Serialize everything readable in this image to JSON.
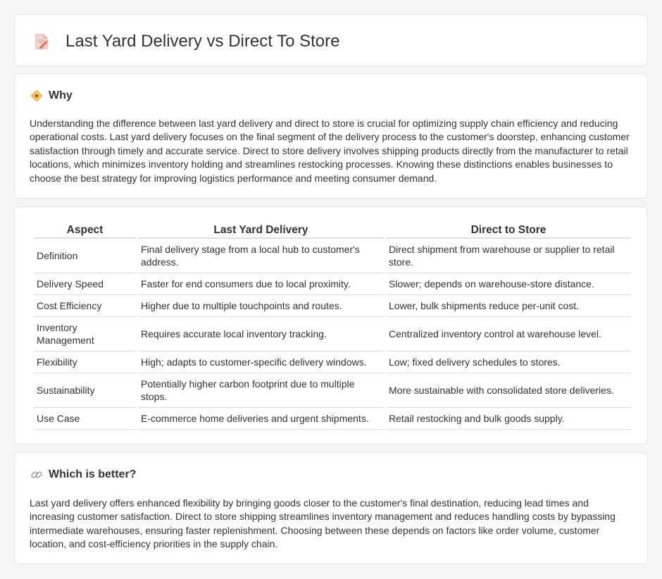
{
  "header": {
    "title": "Last Yard Delivery vs Direct To Store",
    "icon": "document-pencil-icon"
  },
  "why": {
    "heading": "Why",
    "icon": "diamond-sign-icon",
    "text": "Understanding the difference between last yard delivery and direct to store is crucial for optimizing supply chain efficiency and reducing operational costs. Last yard delivery focuses on the final segment of the delivery process to the customer's doorstep, enhancing customer satisfaction through timely and accurate service. Direct to store delivery involves shipping products directly from the manufacturer to retail locations, which minimizes inventory holding and streamlines restocking processes. Knowing these distinctions enables businesses to choose the best strategy for improving logistics performance and meeting consumer demand."
  },
  "table": {
    "headers": [
      "Aspect",
      "Last Yard Delivery",
      "Direct to Store"
    ],
    "rows": [
      [
        "Definition",
        "Final delivery stage from a local hub to customer's address.",
        "Direct shipment from warehouse or supplier to retail store."
      ],
      [
        "Delivery Speed",
        "Faster for end consumers due to local proximity.",
        "Slower; depends on warehouse-store distance."
      ],
      [
        "Cost Efficiency",
        "Higher due to multiple touchpoints and routes.",
        "Lower, bulk shipments reduce per-unit cost."
      ],
      [
        "Inventory Management",
        "Requires accurate local inventory tracking.",
        "Centralized inventory control at warehouse level."
      ],
      [
        "Flexibility",
        "High; adapts to customer-specific delivery windows.",
        "Low; fixed delivery schedules to stores."
      ],
      [
        "Sustainability",
        "Potentially higher carbon footprint due to multiple stops.",
        "More sustainable with consolidated store deliveries."
      ],
      [
        "Use Case",
        "E-commerce home deliveries and urgent shipments.",
        "Retail restocking and bulk goods supply."
      ]
    ]
  },
  "better": {
    "heading": "Which is better?",
    "icon": "link-icon",
    "text": "Last yard delivery offers enhanced flexibility by bringing goods closer to the customer's final destination, reducing lead times and increasing customer satisfaction. Direct to store shipping streamlines inventory management and reduces handling costs by bypassing intermediate warehouses, ensuring faster replenishment. Choosing between these depends on factors like order volume, customer location, and cost-efficiency priorities in the supply chain."
  }
}
